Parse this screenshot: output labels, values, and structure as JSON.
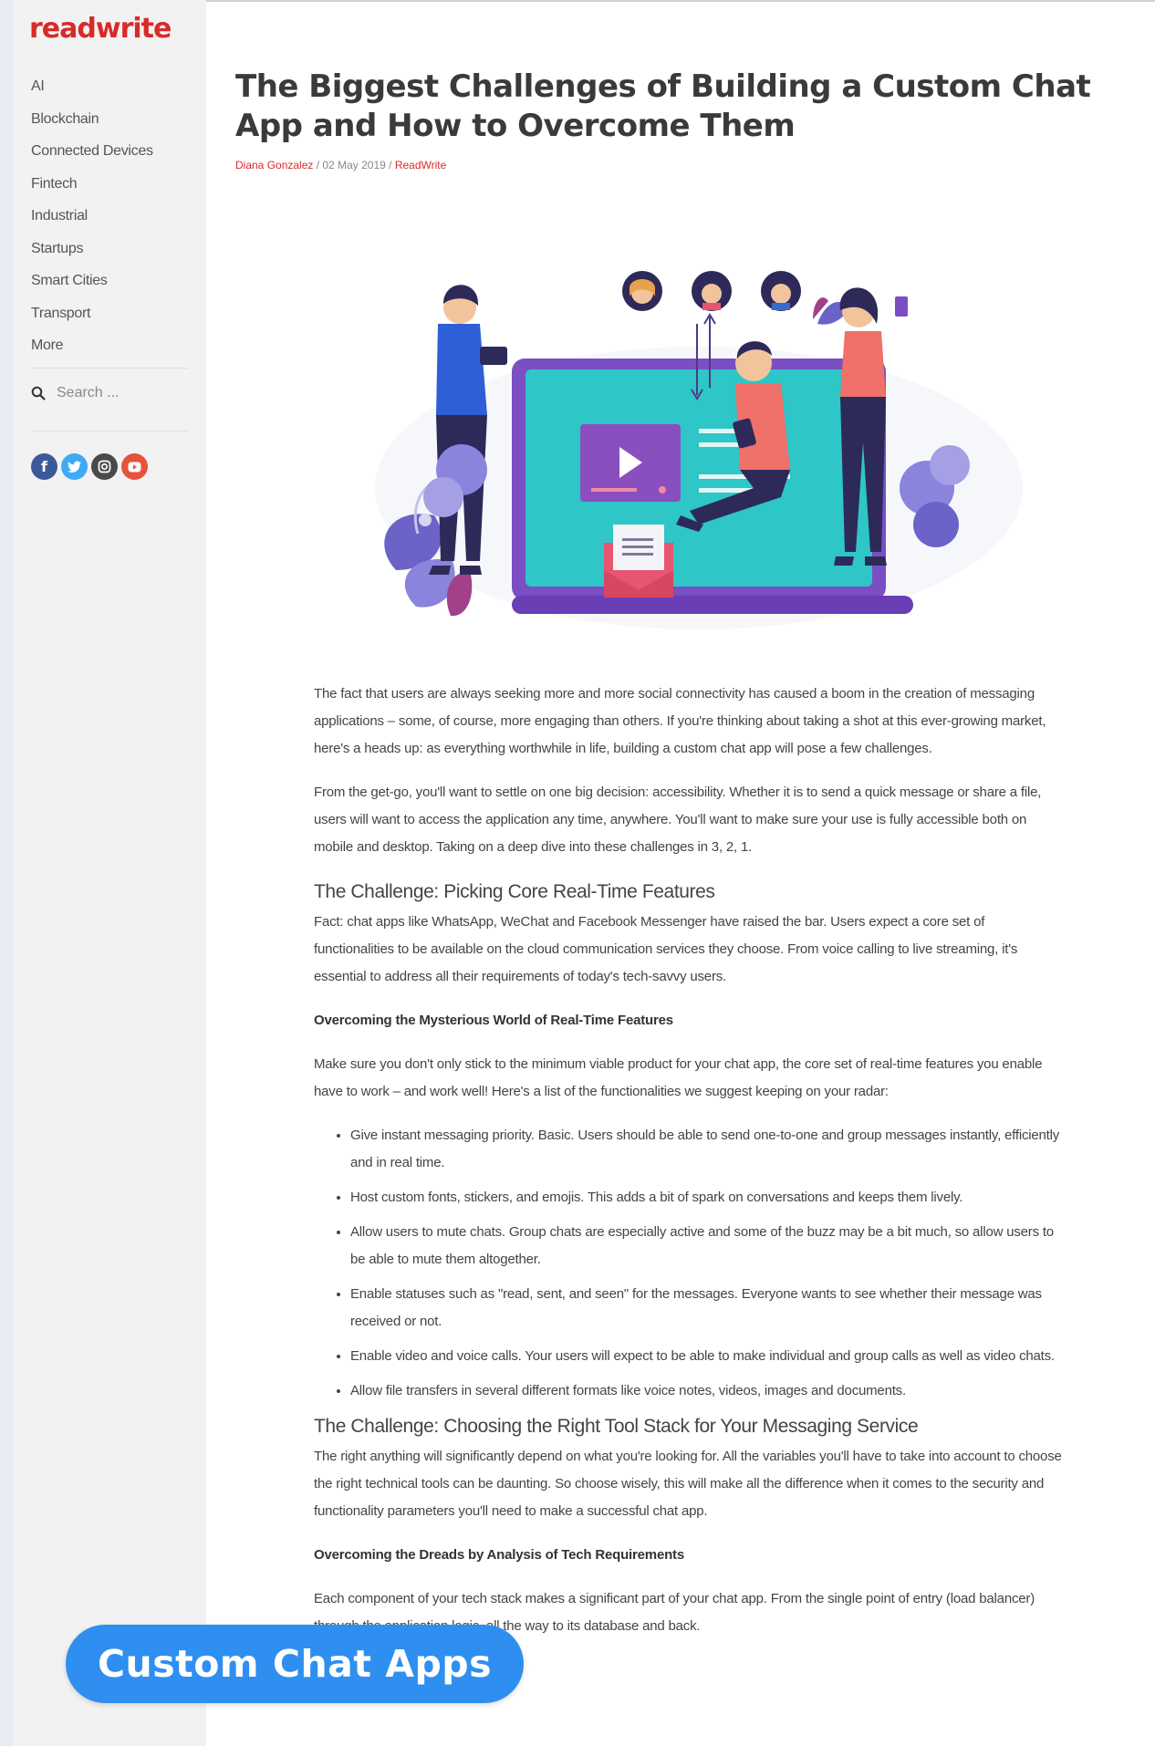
{
  "sidebar": {
    "logo": "readwrite",
    "nav": [
      "AI",
      "Blockchain",
      "Connected Devices",
      "Fintech",
      "Industrial",
      "Startups",
      "Smart Cities",
      "Transport",
      "More"
    ],
    "search_placeholder": "Search ...",
    "social": [
      "facebook-icon",
      "twitter-icon",
      "instagram-icon",
      "youtube-icon"
    ]
  },
  "article": {
    "title": "The Biggest Challenges of Building a Custom Chat App and How to Overcome Them",
    "author": "Diana Gonzalez",
    "date": "02 May 2019",
    "site": "ReadWrite",
    "p1": "The fact that users are always seeking more and more social connectivity has caused a boom in the creation of messaging applications – some, of course, more engaging than others. If you're thinking about taking a shot at this ever-growing market, here's a heads up: as everything worthwhile in life, building a custom chat app will pose a few challenges.",
    "p2": "From the get-go, you'll want to settle on one big decision: accessibility. Whether it is to send a quick message or share a file, users will want to access the application any time, anywhere. You'll want to make sure your use is fully accessible both on mobile and desktop. Taking on a deep dive into these challenges in 3, 2, 1.",
    "h1": "The Challenge: Picking Core Real-Time Features",
    "p3": "Fact: chat apps like WhatsApp, WeChat and Facebook Messenger have raised the bar. Users expect a core set of functionalities to be available on the cloud communication services they choose. From voice calling to live streaming, it's essential to address all their requirements of today's tech-savvy users.",
    "sub1": "Overcoming the Mysterious World of Real-Time Features",
    "p4": "Make sure you don't only stick to the minimum viable product for your chat app, the core set of real-time features you enable have to work – and work well! Here's a list of the functionalities we suggest keeping on your radar:",
    "bullets": [
      "Give instant messaging priority. Basic. Users should be able to send one-to-one and group messages instantly, efficiently and in real time.",
      "Host custom fonts, stickers, and emojis. This adds a bit of spark on conversations and keeps them lively.",
      "Allow users to mute chats. Group chats are especially active and some of the buzz may be a bit much, so allow users to be able to mute them altogether.",
      "Enable statuses such as \"read, sent, and seen\" for the messages. Everyone wants to see whether their message was received or not.",
      "Enable video and voice calls. Your users will expect to be able to make individual and group calls as well as video chats.",
      "Allow file transfers in several different formats like voice notes, videos, images and documents."
    ],
    "h2": "The Challenge: Choosing the Right Tool Stack for Your Messaging Service",
    "p5": "The right anything will significantly depend on what you're looking for. All the variables you'll have to take into account to choose the right technical tools can be daunting. So choose wisely, this will make all the difference when it comes to the security and functionality parameters you'll need to make a successful chat app.",
    "sub2": "Overcoming the Dreads by Analysis of Tech Requirements",
    "p6": "Each component of your tech stack makes a significant part of your chat app. From the single point of entry (load balancer) through the application logic, all the way to its database and back."
  },
  "badge": {
    "label": "Custom Chat Apps"
  },
  "colors": {
    "brand_red": "#d92a2a",
    "badge_blue": "#2e8ff0",
    "sidebar_bg": "#f2f2f2"
  }
}
